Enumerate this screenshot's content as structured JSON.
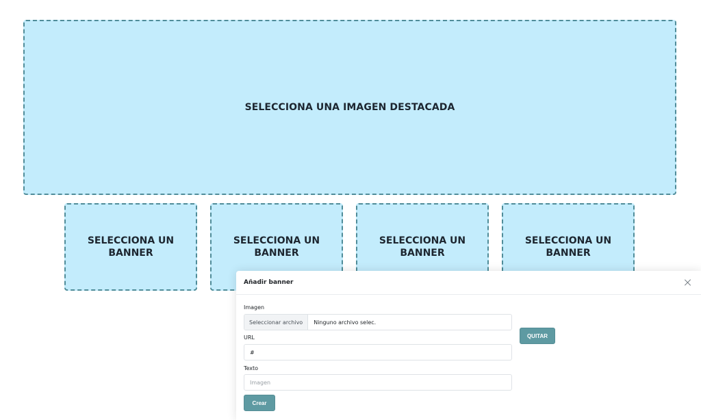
{
  "featured": {
    "label": "SELECCIONA UNA IMAGEN DESTACADA"
  },
  "banners": [
    {
      "label": "SELECCIONA UN BANNER"
    },
    {
      "label": "SELECCIONA UN BANNER"
    },
    {
      "label": "SELECCIONA UN BANNER"
    },
    {
      "label": "SELECCIONA UN BANNER"
    }
  ],
  "modal": {
    "title": "Añadir banner",
    "close_icon": "close-icon",
    "image_label": "Imagen",
    "file_button": "Seleccionar archivo",
    "file_name": "Ninguno archivo selec.",
    "remove_button": "QUITAR",
    "url_label": "URL",
    "url_value": "#",
    "text_label": "Texto",
    "text_placeholder": "Imagen",
    "create_button": "Crear"
  },
  "colors": {
    "dropzone_bg": "#c3ecfc",
    "dropzone_border": "#4f8c99",
    "accent_button": "#5e9aa2"
  }
}
